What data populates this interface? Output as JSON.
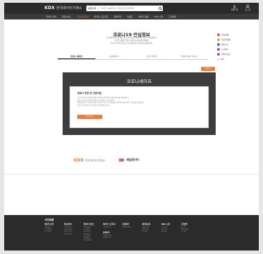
{
  "header": {
    "logo_brand": "KDX",
    "logo_text": "한국데이터거래소",
    "search_category": "통합검색",
    "search_placeholder": "데이터 상품명 등 키워드를 입력하세요",
    "icons": [
      {
        "name": "login-icon",
        "label": "회원가입"
      },
      {
        "name": "user-icon",
        "label": "로그인"
      }
    ]
  },
  "nav": {
    "items": [
      "데이터 검색",
      "전문서비스",
      "코로나세이프",
      "데이터 스토리지",
      "큐레이터",
      "이벤트",
      "데이터 등록",
      "KDX 소개",
      "고객센터"
    ],
    "active_index": 2
  },
  "page": {
    "title": "코로나19 안심정보",
    "description_lines": [
      "한국데이터거래소에서 코로나19 관련 데이터를 무료로 제공합니다",
      "안전한 일상을 위한 다양한 정보를 확인하세요",
      "코로나19 확진자 동선 및 선별진료소 정보를 제공합니다"
    ]
  },
  "quick_menu": [
    {
      "label": "관심상품",
      "color": "#e8543a"
    },
    {
      "label": "최근본상품",
      "color": "#f4a62a"
    },
    {
      "label": "장바구니",
      "color": "#3b6fd8"
    },
    {
      "label": "1:1문의",
      "color": "#d04a7a"
    },
    {
      "label": "데이터신청",
      "color": "#8a5bd6"
    },
    {
      "label": "TOP",
      "color": "#bbbbbb"
    }
  ],
  "tabs": [
    "코로나 세이프",
    "공공데이터",
    "민간 데이터",
    "데이터 분석 서비스"
  ],
  "apply_button": "신청하기",
  "panel": {
    "title": "코로나세이프",
    "card_heading": "코로나 안전 안 기분식업",
    "card_lines": [
      "코로나19 확산 방지를 위해 음식점 정보와 방역 현황 데이터를 제공합니다.",
      "방문 전 안전한 식당을 확인하고 안심하고 이용하세요.",
      "식당별 방역 수칙 준수 여부, 좌석 간 거리두기, 테이블 간 칸막이 설치 여부 등 정보를 제공합니다.",
      "제공되는 데이터는 주기적으로 업데이트됩니다."
    ],
    "card_button": "자세히 보기"
  },
  "partners": {
    "kdx_brand": "KDX",
    "kdx_text": "한국데이터거래소",
    "partner2": "매일항(주)"
  },
  "footer": {
    "title": "사이트맵",
    "columns": [
      {
        "heading": "데이터 검색",
        "links": [
          "전체 데이터",
          "공공 데이터",
          "민간 데이터"
        ]
      },
      {
        "heading": "전문서비스",
        "links": [
          "분석 서비스",
          "시각화 서비스",
          "컨설팅 서비스",
          "AI 학습데이터"
        ]
      },
      {
        "heading": "데이터 서비스",
        "links": [
          "코로나세이프",
          "관광 데이터",
          "상권 데이터",
          "유통 데이터",
          "금융 데이터",
          "교통 데이터",
          "부동산 데이터"
        ]
      },
      {
        "heading": "데이터 스토리지",
        "links": [
          "스토리지 소개"
        ],
        "heading2": "큐레이터",
        "links2": [
          "큐레이터 소개",
          "큐레이터 신청"
        ]
      },
      {
        "heading": "큐레이터",
        "links": [
          "큐레이터 목록"
        ]
      },
      {
        "heading": "데이터등록",
        "links": [
          "판매자 신청",
          "데이터 등록",
          "등록 현황"
        ]
      },
      {
        "heading": "KDX 소개",
        "links": [
          "KDX 소개",
          "오시는 길",
          "제휴 문의"
        ]
      },
      {
        "heading": "고객센터",
        "links": [
          "공지사항",
          "자주묻는질문",
          "1:1 문의"
        ]
      }
    ]
  }
}
